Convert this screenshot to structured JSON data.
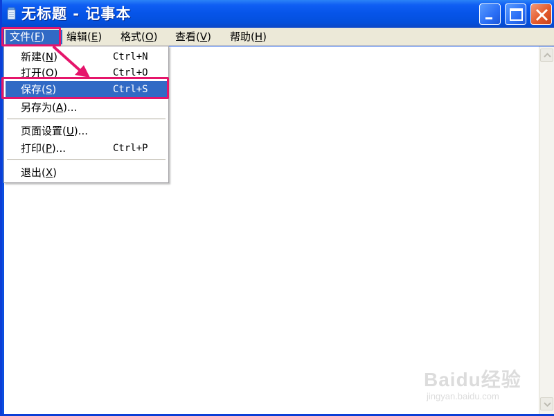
{
  "window": {
    "title": "无标题 - 记事本",
    "icon": "notepad-icon",
    "controls": [
      "minimize-icon",
      "maximize-icon",
      "close-icon"
    ]
  },
  "menubar": {
    "items": [
      {
        "label": "文件(",
        "mnemonic": "F",
        "suffix": ")",
        "active": true
      },
      {
        "label": "编辑(",
        "mnemonic": "E",
        "suffix": ")"
      },
      {
        "label": "格式(",
        "mnemonic": "O",
        "suffix": ")"
      },
      {
        "label": "查看(",
        "mnemonic": "V",
        "suffix": ")"
      },
      {
        "label": "帮助(",
        "mnemonic": "H",
        "suffix": ")"
      }
    ]
  },
  "file_menu": {
    "new": {
      "label": "新建(",
      "mnemonic": "N",
      "suffix": ")",
      "shortcut": "Ctrl+N"
    },
    "open": {
      "label": "打开(",
      "mnemonic": "O",
      "suffix": ")",
      "shortcut": "Ctrl+O"
    },
    "save": {
      "label": "保存(",
      "mnemonic": "S",
      "suffix": ")",
      "shortcut": "Ctrl+S",
      "selected": true
    },
    "save_as": {
      "label": "另存为(",
      "mnemonic": "A",
      "suffix": ")..."
    },
    "page_setup": {
      "label": "页面设置(",
      "mnemonic": "U",
      "suffix": ")..."
    },
    "print": {
      "label": "打印(",
      "mnemonic": "P",
      "suffix": ")...",
      "shortcut": "Ctrl+P"
    },
    "exit": {
      "label": "退出(",
      "mnemonic": "X",
      "suffix": ")"
    }
  },
  "watermark": {
    "logo": "Baidu经验",
    "url": "jingyan.baidu.com"
  },
  "colors": {
    "titlebar": "#0654e8",
    "menu_highlight": "#316ac5",
    "annotation": "#e5156b",
    "menubar_bg": "#ece9d8"
  }
}
